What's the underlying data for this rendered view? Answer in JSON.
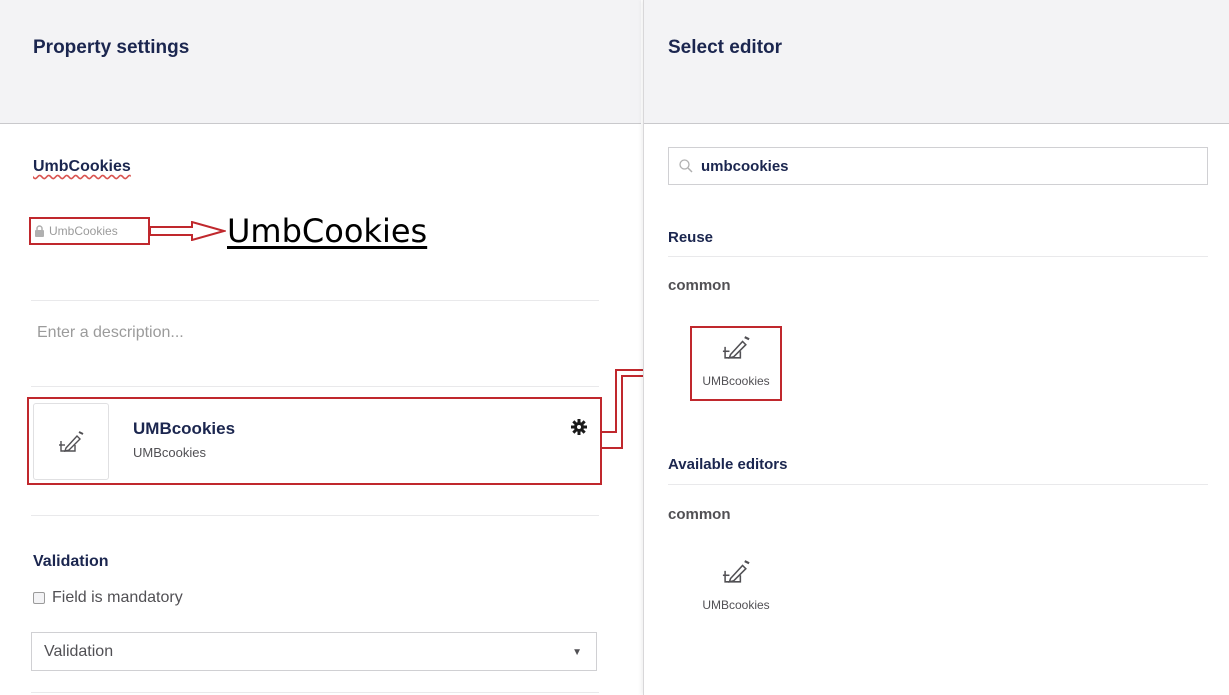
{
  "left_panel": {
    "header_title": "Property settings",
    "property_name": "UmbCookies",
    "alias": "UmbCookies",
    "annotation_label": "UmbCookies",
    "description_placeholder": "Enter a description...",
    "editor": {
      "name": "UMBcookies",
      "alias": "UMBcookies",
      "icon": "edit-icon"
    },
    "validation": {
      "title": "Validation",
      "mandatory_label": "Field is mandatory",
      "mandatory_checked": false,
      "select_value": "Validation"
    }
  },
  "right_panel": {
    "header_title": "Select editor",
    "search_value": "umbcookies",
    "reuse": {
      "title": "Reuse",
      "group": "common",
      "items": [
        {
          "label": "UMBcookies",
          "icon": "edit-icon"
        }
      ]
    },
    "available": {
      "title": "Available editors",
      "group": "common",
      "items": [
        {
          "label": "UMBcookies",
          "icon": "edit-icon"
        }
      ]
    }
  },
  "colors": {
    "annotation": "#c0282d",
    "header_bg": "#f3f3f5",
    "text": "#1b264f"
  }
}
